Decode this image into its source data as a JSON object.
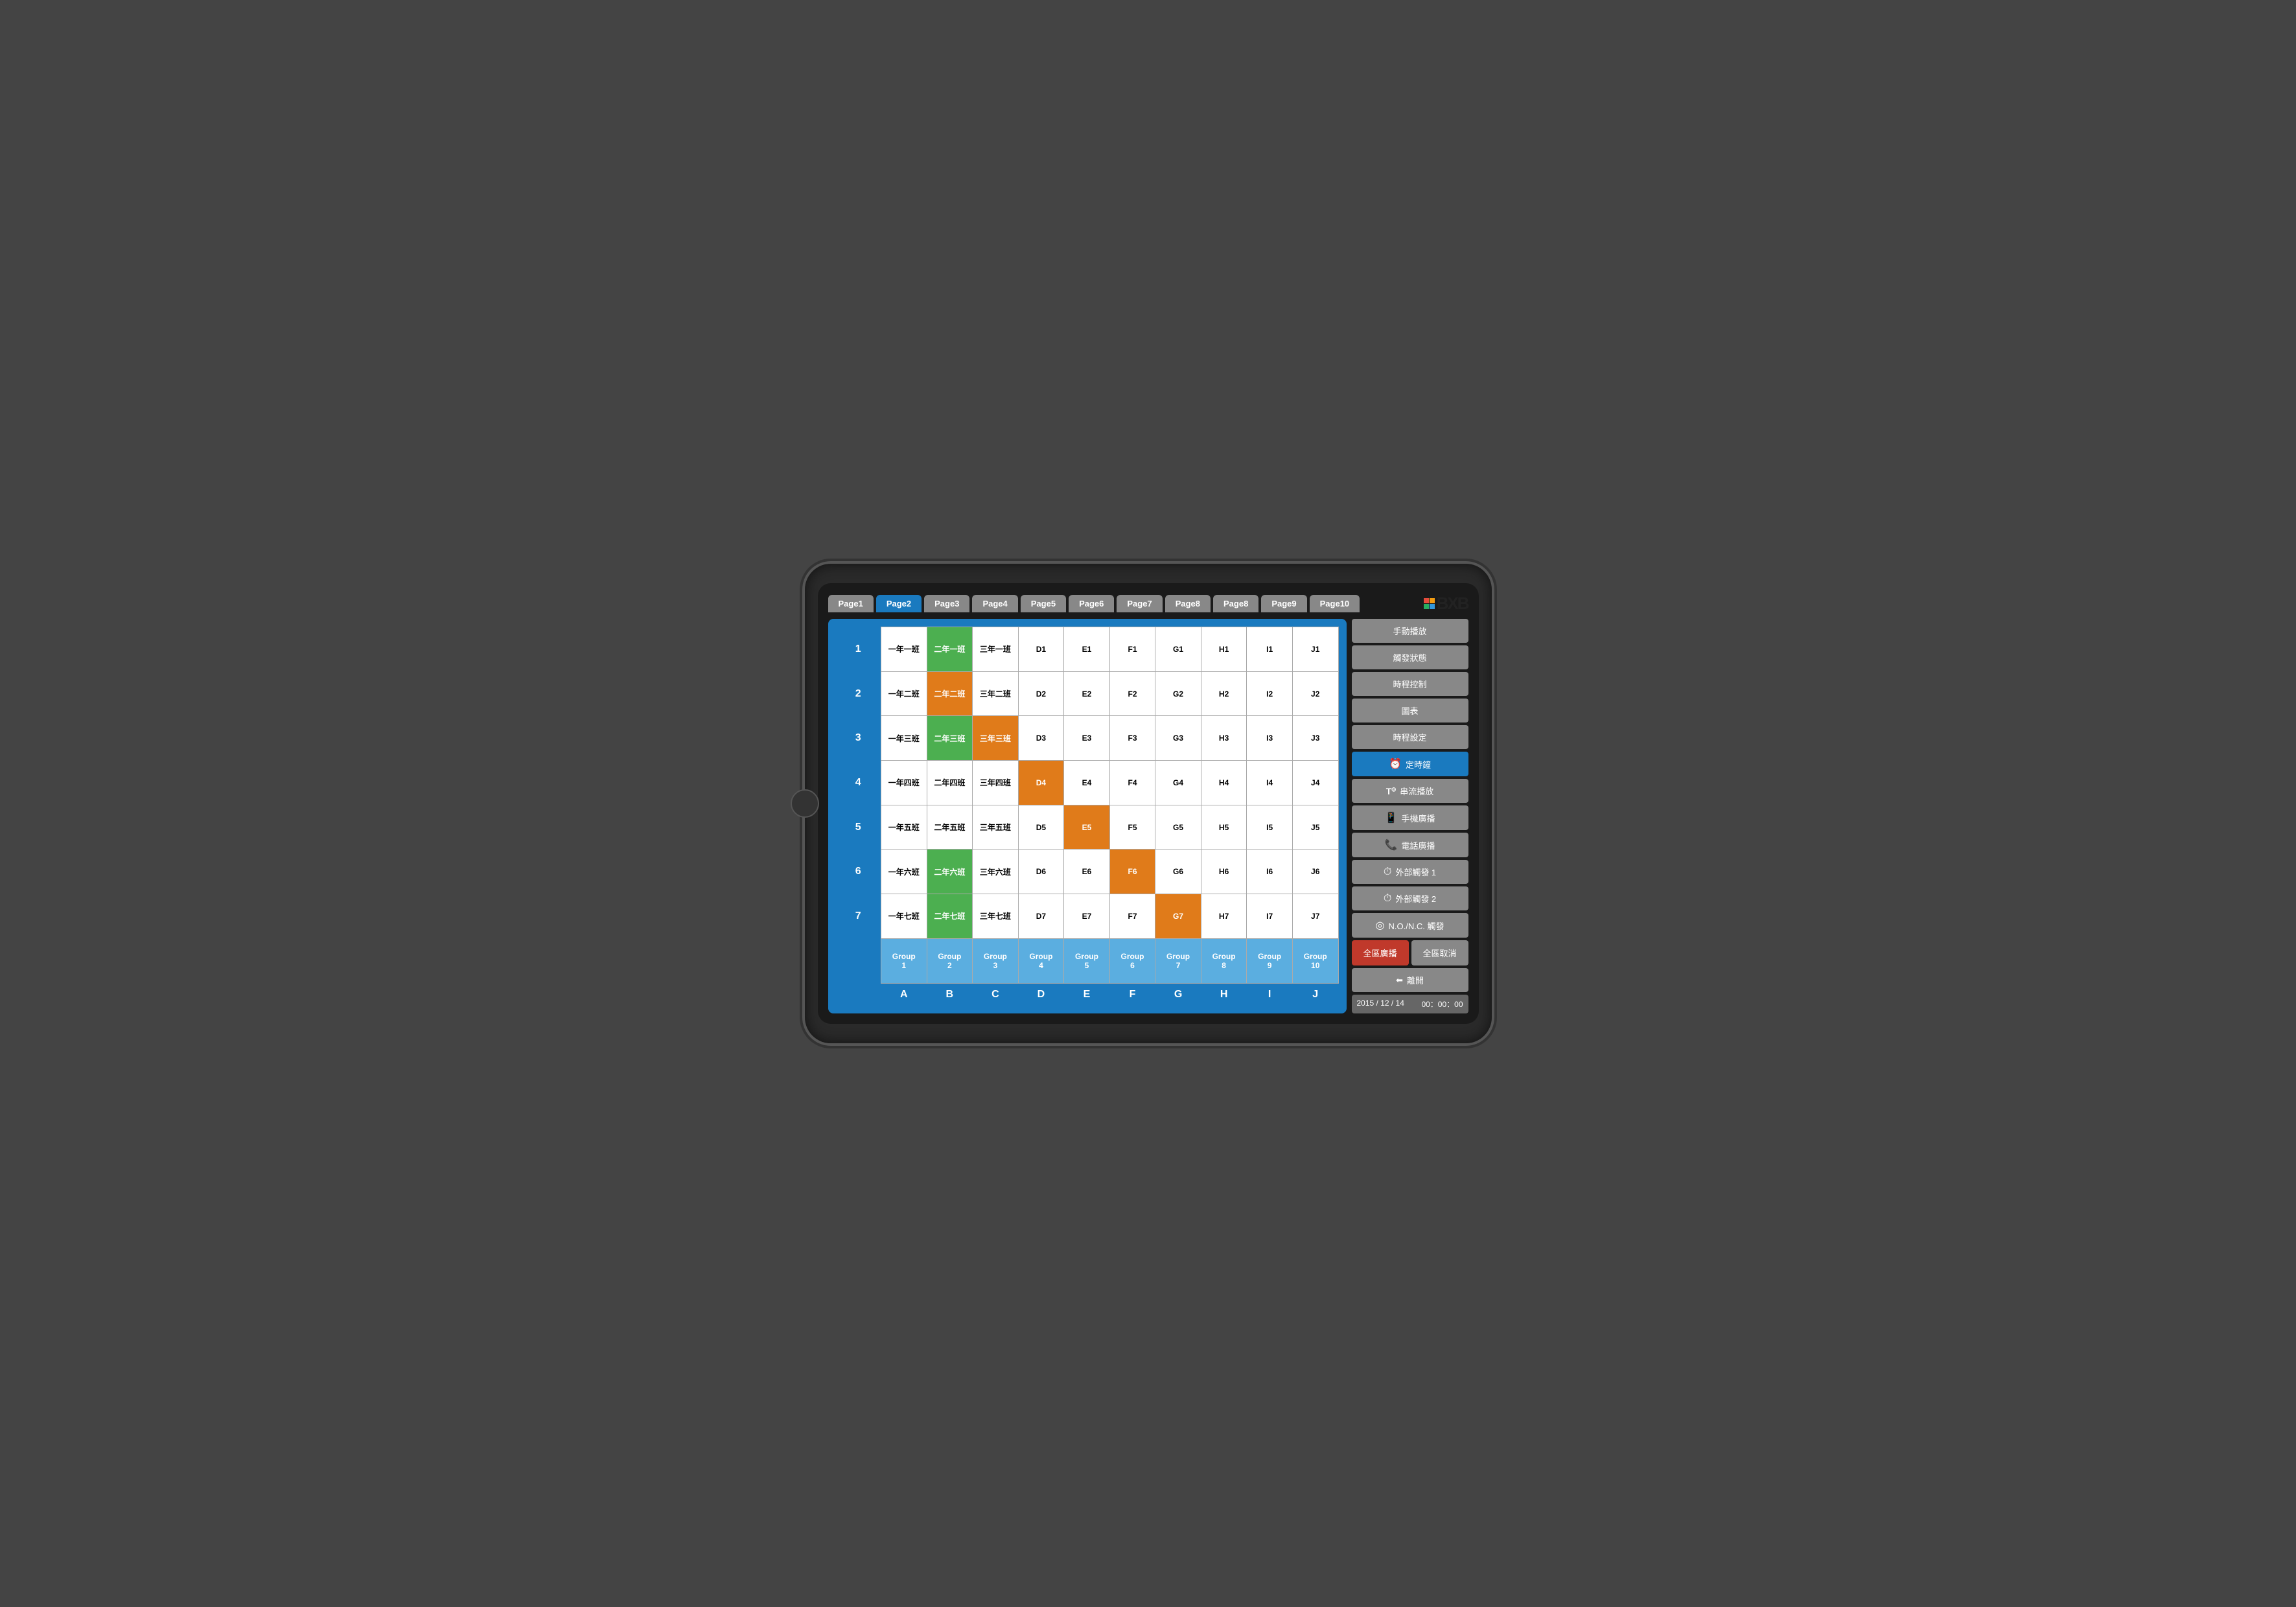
{
  "tabs": [
    {
      "label": "Page1",
      "active": false
    },
    {
      "label": "Page2",
      "active": true
    },
    {
      "label": "Page3",
      "active": false
    },
    {
      "label": "Page4",
      "active": false
    },
    {
      "label": "Page5",
      "active": false
    },
    {
      "label": "Page6",
      "active": false
    },
    {
      "label": "Page7",
      "active": false
    },
    {
      "label": "Page8",
      "active": false
    },
    {
      "label": "Page8",
      "active": false
    },
    {
      "label": "Page9",
      "active": false
    },
    {
      "label": "Page10",
      "active": false
    }
  ],
  "grid": {
    "cols": [
      "A",
      "B",
      "C",
      "D",
      "E",
      "F",
      "G",
      "H",
      "I",
      "J"
    ],
    "rows": [
      {
        "num": "1",
        "cells": [
          {
            "text": "一年一班",
            "color": "white"
          },
          {
            "text": "二年一班",
            "color": "green"
          },
          {
            "text": "三年一班",
            "color": "white"
          },
          {
            "text": "D1",
            "color": "white"
          },
          {
            "text": "E1",
            "color": "white"
          },
          {
            "text": "F1",
            "color": "white"
          },
          {
            "text": "G1",
            "color": "white"
          },
          {
            "text": "H1",
            "color": "white"
          },
          {
            "text": "I1",
            "color": "white"
          },
          {
            "text": "J1",
            "color": "white"
          }
        ]
      },
      {
        "num": "2",
        "cells": [
          {
            "text": "一年二班",
            "color": "white"
          },
          {
            "text": "二年二班",
            "color": "orange"
          },
          {
            "text": "三年二班",
            "color": "white"
          },
          {
            "text": "D2",
            "color": "white"
          },
          {
            "text": "E2",
            "color": "white"
          },
          {
            "text": "F2",
            "color": "white"
          },
          {
            "text": "G2",
            "color": "white"
          },
          {
            "text": "H2",
            "color": "white"
          },
          {
            "text": "I2",
            "color": "white"
          },
          {
            "text": "J2",
            "color": "white"
          }
        ]
      },
      {
        "num": "3",
        "cells": [
          {
            "text": "一年三班",
            "color": "white"
          },
          {
            "text": "二年三班",
            "color": "green"
          },
          {
            "text": "三年三班",
            "color": "orange"
          },
          {
            "text": "D3",
            "color": "white"
          },
          {
            "text": "E3",
            "color": "white"
          },
          {
            "text": "F3",
            "color": "white"
          },
          {
            "text": "G3",
            "color": "white"
          },
          {
            "text": "H3",
            "color": "white"
          },
          {
            "text": "I3",
            "color": "white"
          },
          {
            "text": "J3",
            "color": "white"
          }
        ]
      },
      {
        "num": "4",
        "cells": [
          {
            "text": "一年四班",
            "color": "white"
          },
          {
            "text": "二年四班",
            "color": "white"
          },
          {
            "text": "三年四班",
            "color": "white"
          },
          {
            "text": "D4",
            "color": "orange"
          },
          {
            "text": "E4",
            "color": "white"
          },
          {
            "text": "F4",
            "color": "white"
          },
          {
            "text": "G4",
            "color": "white"
          },
          {
            "text": "H4",
            "color": "white"
          },
          {
            "text": "I4",
            "color": "white"
          },
          {
            "text": "J4",
            "color": "white"
          }
        ]
      },
      {
        "num": "5",
        "cells": [
          {
            "text": "一年五班",
            "color": "white"
          },
          {
            "text": "二年五班",
            "color": "white"
          },
          {
            "text": "三年五班",
            "color": "white"
          },
          {
            "text": "D5",
            "color": "white"
          },
          {
            "text": "E5",
            "color": "orange"
          },
          {
            "text": "F5",
            "color": "white"
          },
          {
            "text": "G5",
            "color": "white"
          },
          {
            "text": "H5",
            "color": "white"
          },
          {
            "text": "I5",
            "color": "white"
          },
          {
            "text": "J5",
            "color": "white"
          }
        ]
      },
      {
        "num": "6",
        "cells": [
          {
            "text": "一年六班",
            "color": "white"
          },
          {
            "text": "二年六班",
            "color": "green"
          },
          {
            "text": "三年六班",
            "color": "white"
          },
          {
            "text": "D6",
            "color": "white"
          },
          {
            "text": "E6",
            "color": "white"
          },
          {
            "text": "F6",
            "color": "orange"
          },
          {
            "text": "G6",
            "color": "white"
          },
          {
            "text": "H6",
            "color": "white"
          },
          {
            "text": "I6",
            "color": "white"
          },
          {
            "text": "J6",
            "color": "white"
          }
        ]
      },
      {
        "num": "7",
        "cells": [
          {
            "text": "一年七班",
            "color": "white"
          },
          {
            "text": "二年七班",
            "color": "green"
          },
          {
            "text": "三年七班",
            "color": "white"
          },
          {
            "text": "D7",
            "color": "white"
          },
          {
            "text": "E7",
            "color": "white"
          },
          {
            "text": "F7",
            "color": "white"
          },
          {
            "text": "G7",
            "color": "orange"
          },
          {
            "text": "H7",
            "color": "white"
          },
          {
            "text": "I7",
            "color": "white"
          },
          {
            "text": "J7",
            "color": "white"
          }
        ]
      }
    ],
    "groups": [
      "Group\n1",
      "Group\n2",
      "Group\n3",
      "Group\n4",
      "Group\n5",
      "Group\n6",
      "Group\n7",
      "Group\n8",
      "Group\n9",
      "Group\n10"
    ]
  },
  "sidebar": {
    "menu": [
      {
        "label": "手動播放",
        "icon": "",
        "active": false
      },
      {
        "label": "觸發狀態",
        "icon": "",
        "active": false
      },
      {
        "label": "時程控制",
        "icon": "",
        "active": false
      },
      {
        "label": "圖表",
        "icon": "",
        "active": false
      },
      {
        "label": "時程設定",
        "icon": "",
        "active": false
      },
      {
        "label": "定時鐘",
        "icon": "⏰",
        "active": true
      },
      {
        "label": "串流播放",
        "icon": "T",
        "active": false
      },
      {
        "label": "手機廣播",
        "icon": "📱",
        "active": false
      },
      {
        "label": "電話廣播",
        "icon": "📞",
        "active": false
      },
      {
        "label": "外部觸發 1",
        "icon": "⏱",
        "active": false
      },
      {
        "label": "外部觸發 2",
        "icon": "⏱",
        "active": false
      },
      {
        "label": "N.O./N.C. 觸發",
        "icon": "⏱",
        "active": false
      }
    ],
    "btn_broadcast": "全區廣播",
    "btn_cancel": "全區取消",
    "btn_exit": "離開",
    "datetime": "2015 / 12 / 14",
    "time": "00：00：00"
  }
}
